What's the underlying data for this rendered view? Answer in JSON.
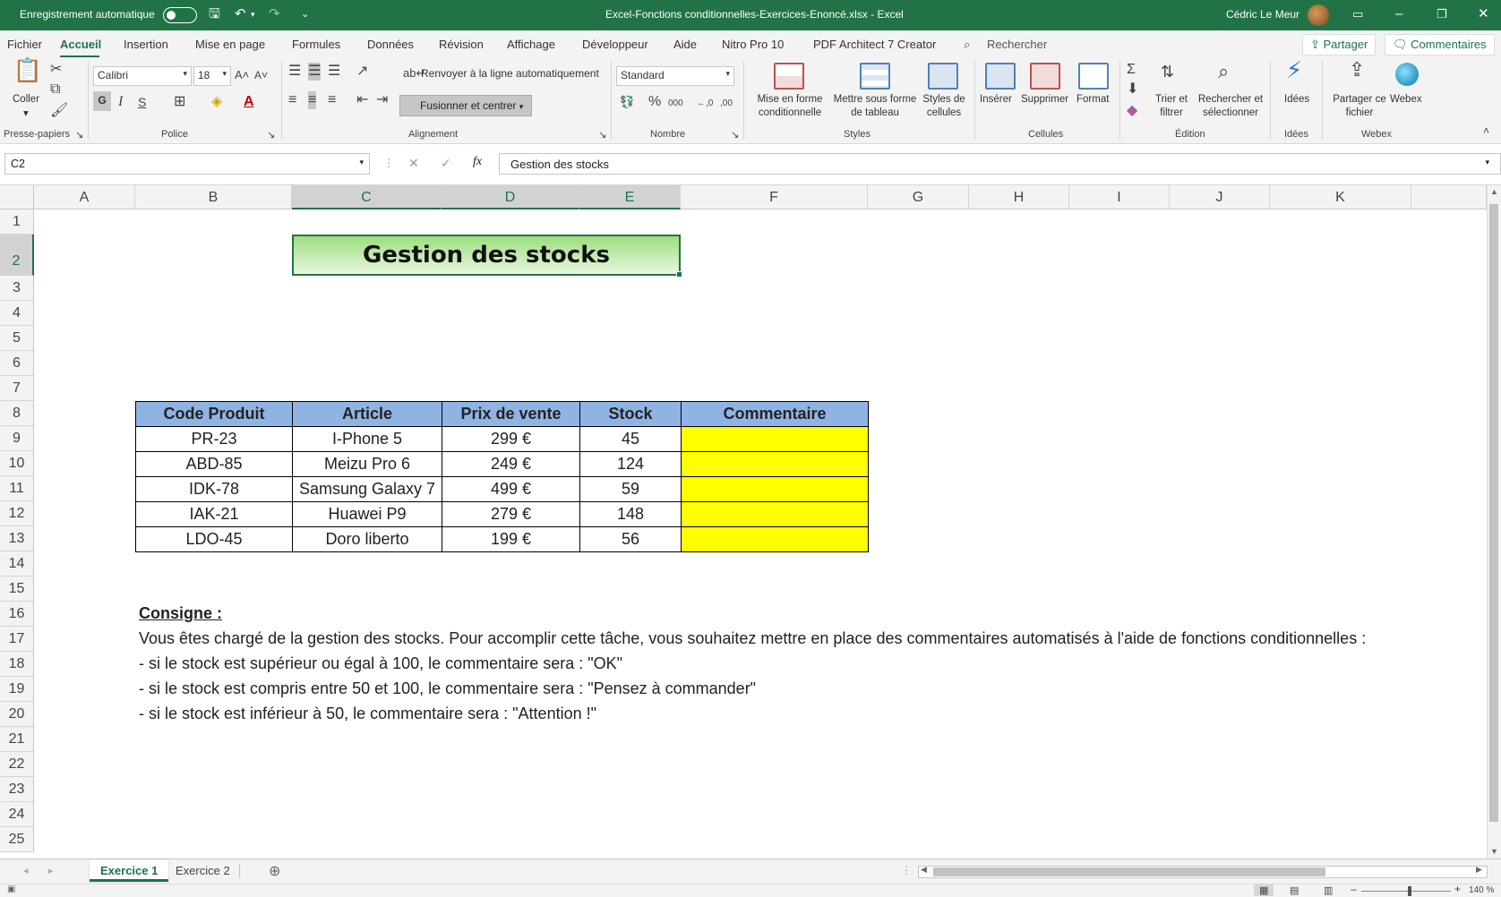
{
  "titlebar": {
    "autosave_label": "Enregistrement automatique",
    "document_title": "Excel-Fonctions conditionnelles-Exercices-Enoncé.xlsx  -  Excel",
    "user_name": "Cédric Le Meur"
  },
  "menu": {
    "items": [
      "Fichier",
      "Accueil",
      "Insertion",
      "Mise en page",
      "Formules",
      "Données",
      "Révision",
      "Affichage",
      "Développeur",
      "Aide",
      "Nitro Pro 10",
      "PDF Architect 7 Creator"
    ],
    "active": "Accueil",
    "search_label": "Rechercher",
    "share_label": "Partager",
    "comments_label": "Commentaires"
  },
  "ribbon": {
    "clipboard": {
      "paste_label": "Coller",
      "group_label": "Presse-papiers"
    },
    "font": {
      "font_name": "Calibri",
      "font_size": "18",
      "bold": "G",
      "italic": "I",
      "underline": "S",
      "group_label": "Police"
    },
    "alignment": {
      "wrap_label": "Renvoyer à la ligne automatiquement",
      "merge_label": "Fusionner et centrer",
      "group_label": "Alignement"
    },
    "number": {
      "format": "Standard",
      "group_label": "Nombre"
    },
    "styles": {
      "conditional_label": "Mise en forme\nconditionnelle",
      "table_label": "Mettre sous forme\nde tableau",
      "cell_styles_label": "Styles de\ncellules",
      "group_label": "Styles"
    },
    "cells": {
      "insert_label": "Insérer",
      "delete_label": "Supprimer",
      "format_label": "Format",
      "group_label": "Cellules"
    },
    "editing": {
      "sort_label": "Trier et\nfiltrer",
      "find_label": "Rechercher et\nsélectionner",
      "group_label": "Édition"
    },
    "ideas": {
      "ideas_label": "Idées",
      "group_label": "Idées"
    },
    "webex": {
      "share_file_label": "Partager ce\nfichier",
      "webex_label": "Webex",
      "group_label": "Webex"
    }
  },
  "formula_bar": {
    "cell_ref": "C2",
    "content": "Gestion des stocks"
  },
  "columns": [
    "A",
    "B",
    "C",
    "D",
    "E",
    "F",
    "G",
    "H",
    "I",
    "J",
    "K"
  ],
  "rows": [
    "1",
    "2",
    "3",
    "4",
    "5",
    "6",
    "7",
    "8",
    "9",
    "10",
    "11",
    "12",
    "13",
    "14",
    "15",
    "16",
    "17",
    "18",
    "19",
    "20",
    "21",
    "22",
    "23",
    "24",
    "25"
  ],
  "sheet": {
    "title": "Gestion des stocks",
    "table": {
      "headers": [
        "Code Produit",
        "Article",
        "Prix de vente",
        "Stock",
        "Commentaire"
      ],
      "rows": [
        [
          "PR-23",
          "I-Phone 5",
          "299 €",
          "45",
          ""
        ],
        [
          "ABD-85",
          "Meizu Pro 6",
          "249 €",
          "124",
          ""
        ],
        [
          "IDK-78",
          "Samsung Galaxy 7",
          "499 €",
          "59",
          ""
        ],
        [
          "IAK-21",
          "Huawei P9",
          "279 €",
          "148",
          ""
        ],
        [
          "LDO-45",
          "Doro liberto",
          "199 €",
          "56",
          ""
        ]
      ]
    },
    "consigne_title": "Consigne :",
    "consigne_lines": [
      "Vous êtes chargé de la gestion des stocks. Pour accomplir cette tâche, vous souhaitez mettre en place des commentaires automatisés à l'aide de fonctions conditionnelles :",
      "- si le stock est supérieur ou égal à 100, le commentaire sera : \"OK\"",
      "- si le stock est compris entre 50 et 100, le commentaire sera : \"Pensez à commander\"",
      "- si le stock est inférieur à 50, le commentaire sera : \"Attention !\""
    ]
  },
  "tabs": [
    "Exercice 1",
    "Exercice 2"
  ],
  "status": {
    "zoom": "140 %"
  },
  "colors": {
    "excel_green": "#217346",
    "header_blue": "#8fb4e3",
    "comment_yellow": "#ffff00"
  }
}
